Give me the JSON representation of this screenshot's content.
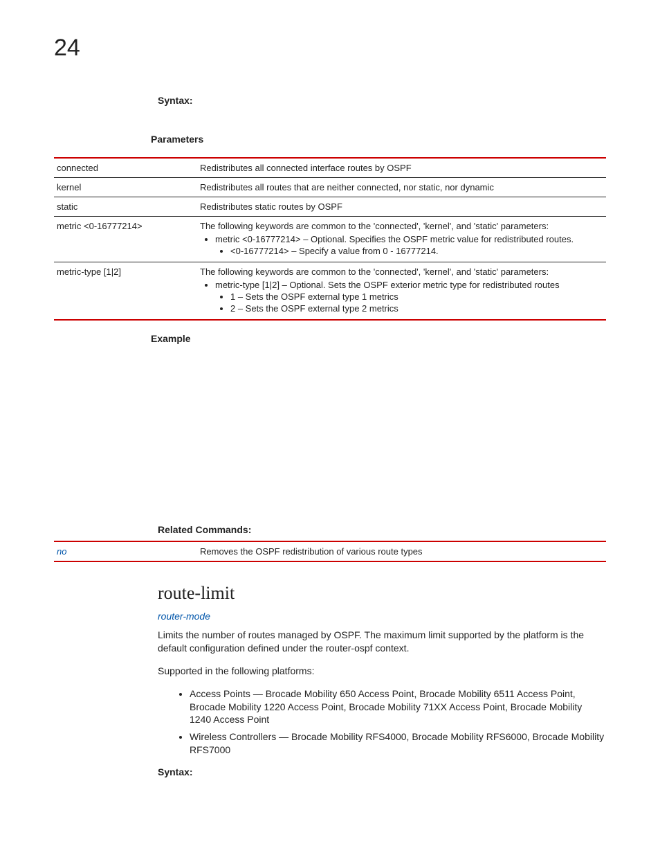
{
  "chapter": "24",
  "syntaxLabel": "Syntax:",
  "parametersLabel": "Parameters",
  "paramsTable": {
    "rows": [
      {
        "name": "connected",
        "desc": "Redistributes all connected interface routes by OSPF"
      },
      {
        "name": "kernel",
        "desc": "Redistributes all routes that are neither connected, nor static, nor dynamic"
      },
      {
        "name": "static",
        "desc": "Redistributes static routes by OSPF"
      }
    ],
    "metricRow": {
      "name": "metric <0-16777214>",
      "intro": "The following keywords are common to the 'connected', 'kernel', and 'static' parameters:",
      "b1": "metric <0-16777214> – Optional. Specifies the OSPF metric value for redistributed routes.",
      "b1a": "<0-16777214> – Specify a value from 0 - 16777214."
    },
    "metricTypeRow": {
      "name": "metric-type [1|2]",
      "intro": "The following keywords are common to the 'connected', 'kernel', and 'static' parameters:",
      "b1": "metric-type [1|2] – Optional. Sets the OSPF exterior metric type for redistributed routes",
      "b1a": "1 – Sets the OSPF external type 1 metrics",
      "b1b": "2 – Sets the OSPF external type 2 metrics"
    }
  },
  "exampleLabel": "Example",
  "relatedLabel": "Related Commands:",
  "relatedRow": {
    "cmd": "no",
    "desc": "Removes the OSPF redistribution of various route types"
  },
  "routeLimit": {
    "title": "route-limit",
    "mode": "router-mode",
    "para1": "Limits the number of routes managed by OSPF. The maximum limit supported by the platform is the default configuration defined under the router-ospf context.",
    "para2": "Supported in the following platforms:",
    "plat1": "Access Points — Brocade Mobility 650 Access Point, Brocade Mobility 6511 Access Point, Brocade Mobility 1220 Access Point, Brocade Mobility 71XX Access Point, Brocade Mobility 1240 Access Point",
    "plat2": "Wireless Controllers — Brocade Mobility RFS4000, Brocade Mobility RFS6000, Brocade Mobility RFS7000",
    "syntax": "Syntax:"
  }
}
